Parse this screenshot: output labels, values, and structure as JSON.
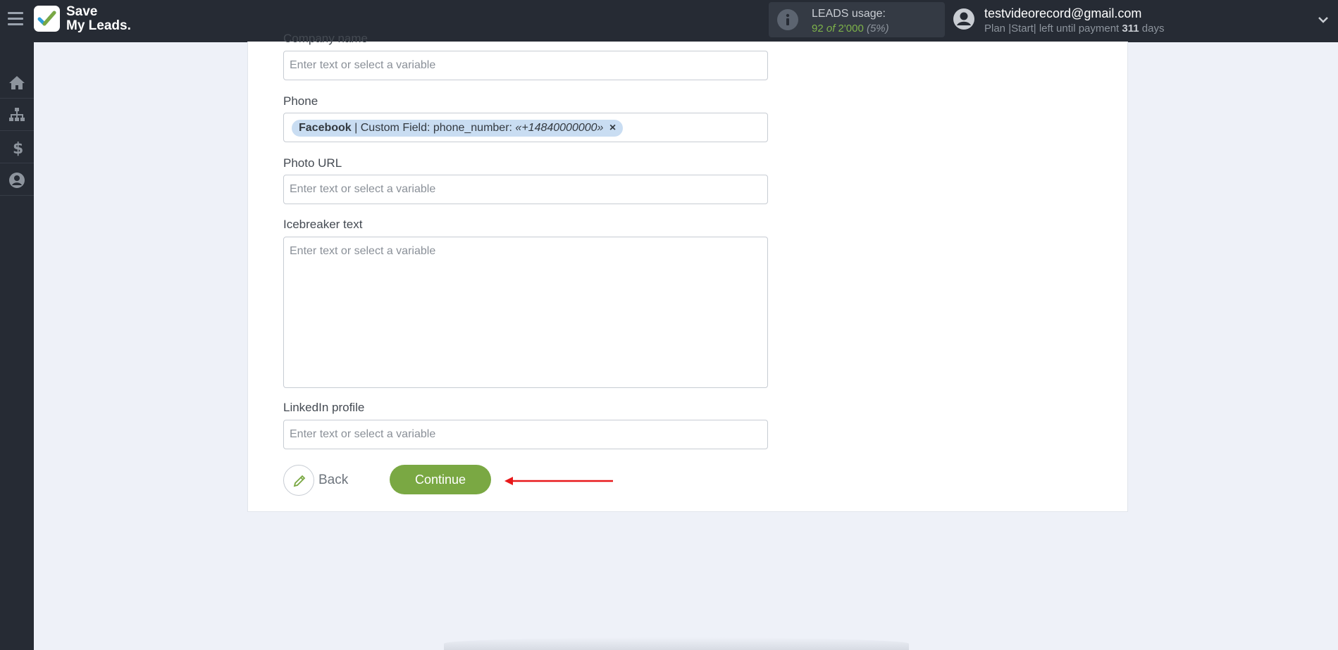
{
  "header": {
    "brand_line1": "Save",
    "brand_line2": "My Leads.",
    "usage_label": "LEADS usage:",
    "usage_used": "92",
    "usage_of": "of",
    "usage_total": "2'000",
    "usage_percent": "(5%)",
    "account_email": "testvideorecord@gmail.com",
    "plan_text": "Plan |Start| left until payment",
    "plan_days": "311",
    "plan_days_suffix": "days"
  },
  "sidebar": {
    "items": [
      {
        "name": "home",
        "icon": "home-icon"
      },
      {
        "name": "connections",
        "icon": "sitemap-icon"
      },
      {
        "name": "billing",
        "icon": "dollar-icon"
      },
      {
        "name": "profile",
        "icon": "user-icon"
      }
    ]
  },
  "form": {
    "partial_label": "Company name",
    "company_placeholder": "Enter text or select a variable",
    "phone_label": "Phone",
    "phone_tag": {
      "source": "Facebook",
      "field": "| Custom Field: phone_number:",
      "value": "«+14840000000»",
      "remove": "×"
    },
    "photo_label": "Photo URL",
    "photo_placeholder": "Enter text or select a variable",
    "icebreaker_label": "Icebreaker text",
    "icebreaker_placeholder": "Enter text or select a variable",
    "linkedin_label": "LinkedIn profile",
    "linkedin_placeholder": "Enter text or select a variable"
  },
  "actions": {
    "back_label": "Back",
    "continue_label": "Continue"
  },
  "colors": {
    "accent": "#7aa843",
    "topbar": "#262b34",
    "arrow": "#e8181a"
  }
}
